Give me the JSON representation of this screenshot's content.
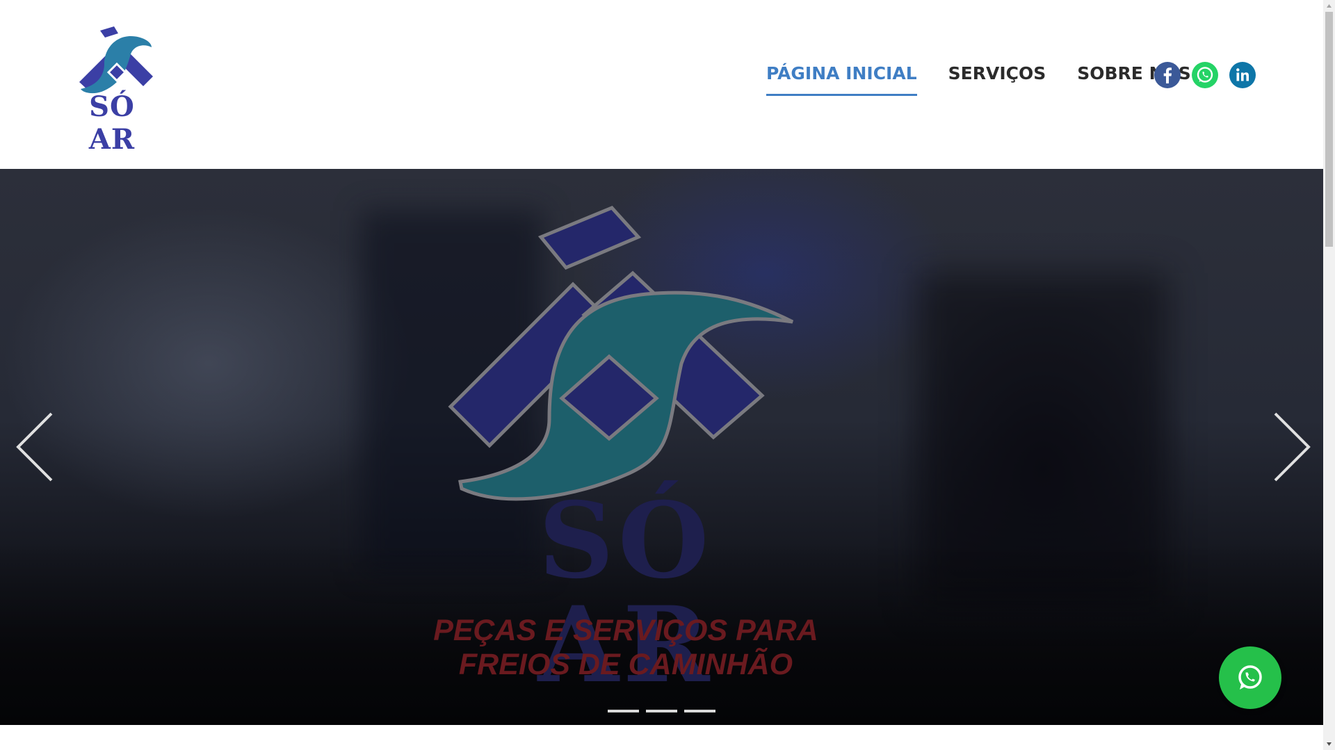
{
  "brand": {
    "logo_text": "SÓ AR"
  },
  "nav": {
    "items": [
      {
        "label": "PÁGINA INICIAL",
        "active": true
      },
      {
        "label": "SERVIÇOS",
        "active": false
      },
      {
        "label": "SOBRE NÓS",
        "active": false
      }
    ]
  },
  "social": [
    {
      "icon": "facebook-icon",
      "color": "#3b5998"
    },
    {
      "icon": "whatsapp-icon",
      "color": "#25d366"
    },
    {
      "icon": "linkedin-icon",
      "color": "#0e76a8"
    }
  ],
  "hero": {
    "brand_text": "SÓ AR",
    "tagline_line1": "PEÇAS E SERVIÇOS PARA",
    "tagline_line2": "FREIOS DE CAMINHÃO",
    "slide_count": 3,
    "active_slide": 1
  },
  "colors": {
    "accent": "#3f7ec4",
    "brand_blue": "#3b3fa5",
    "brand_teal": "#1e6b76",
    "whatsapp_green": "#25c04a"
  }
}
